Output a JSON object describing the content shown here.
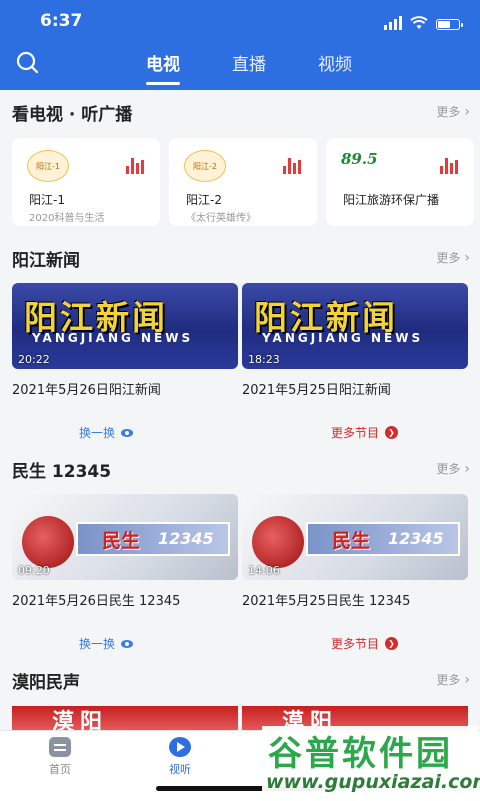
{
  "status": {
    "time": "6:37"
  },
  "nav": {
    "tabs": [
      "电视",
      "直播",
      "视频"
    ],
    "active": 0
  },
  "sections": {
    "radio": {
      "title": "看电视 · 听广播",
      "more": "更多",
      "cards": [
        {
          "name": "阳江-1",
          "sub": "2020科普与生活",
          "logo_text": "阳江-1"
        },
        {
          "name": "阳江-2",
          "sub": "《太行英雄传》",
          "logo_text": "阳江-2"
        },
        {
          "name": "阳江旅游环保广播",
          "sub": "",
          "logo_text": "89.5"
        }
      ]
    },
    "news": {
      "title": "阳江新闻",
      "more": "更多",
      "thumb_big": "阳江新闻",
      "thumb_eng": "YANGJIANG NEWS",
      "videos": [
        {
          "title": "2021年5月26日阳江新闻",
          "duration": "20:22"
        },
        {
          "title": "2021年5月25日阳江新闻",
          "duration": "18:23"
        }
      ],
      "refresh": "换一换",
      "more_programs": "更多节目"
    },
    "minsheng": {
      "title": "民生 12345",
      "more": "更多",
      "thumb_title": "民生",
      "thumb_num": "12345",
      "videos": [
        {
          "title": "2021年5月26日民生 12345",
          "duration": "09:20"
        },
        {
          "title": "2021年5月25日民生 12345",
          "duration": "14:06"
        }
      ],
      "refresh": "换一换",
      "more_programs": "更多节目"
    },
    "moyang": {
      "title": "漠阳民声",
      "more": "更多",
      "peek_text": "漠阳"
    }
  },
  "bottom_nav": {
    "home": "首页",
    "watch": "视听"
  },
  "watermark": {
    "name": "谷普软件园",
    "url": "www.gupuxiazai.com"
  },
  "colors": {
    "primary": "#2d6fe0",
    "accent_red": "#d42a2a"
  }
}
